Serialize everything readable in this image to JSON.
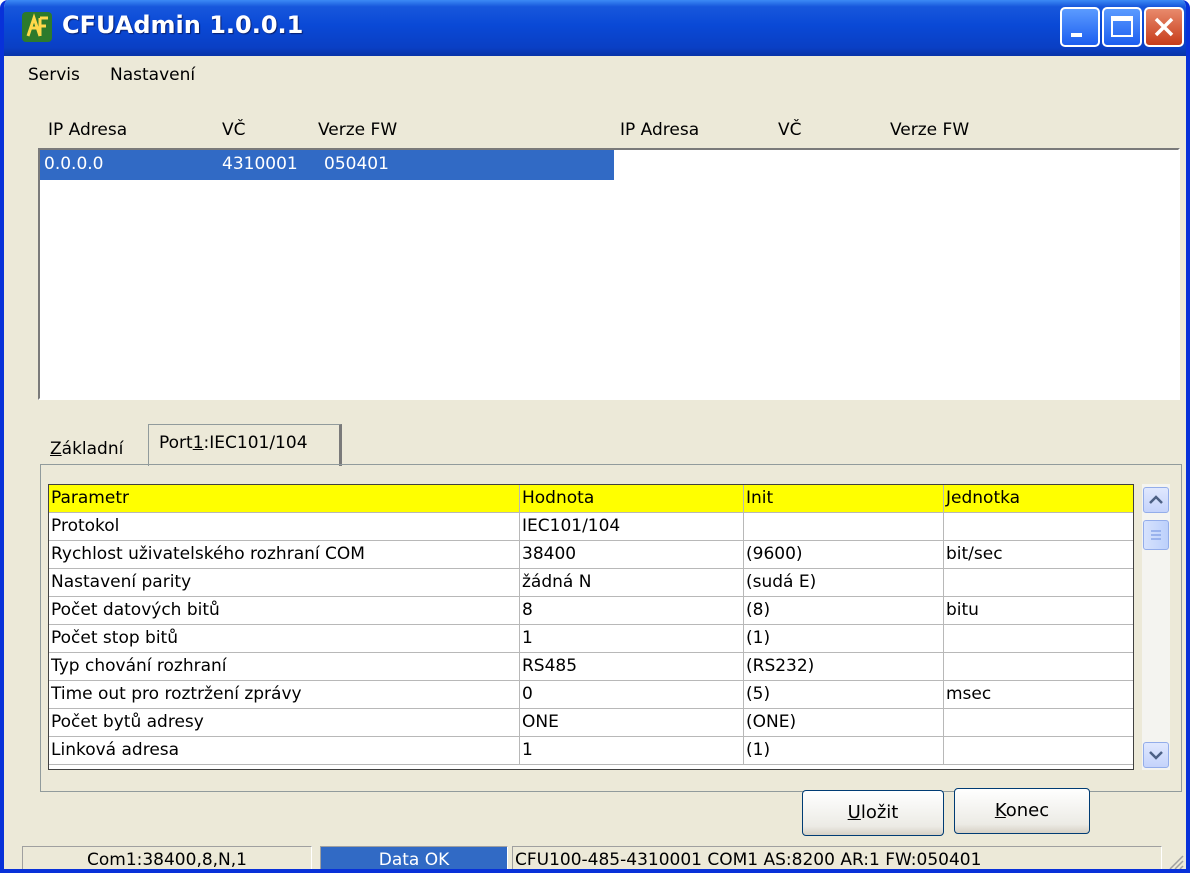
{
  "window": {
    "title": "CFUAdmin 1.0.0.1"
  },
  "menu": {
    "items": [
      "Servis",
      "Nastavení"
    ]
  },
  "device_list": {
    "headers": [
      "IP Adresa",
      "VČ",
      "Verze FW",
      "IP Adresa",
      "VČ",
      "Verze FW"
    ],
    "rows": [
      {
        "ip": "0.0.0.0",
        "vc": "4310001",
        "fw": "050401"
      }
    ]
  },
  "tabs": {
    "basic_first": "Z",
    "basic_rest": "ákladní",
    "port_pre": "Port",
    "port_u": "1",
    "port_post": ":IEC101/104"
  },
  "grid": {
    "headers": [
      "Parametr",
      "Hodnota",
      "Init",
      "Jednotka"
    ],
    "rows": [
      [
        "Protokol",
        "IEC101/104",
        "",
        ""
      ],
      [
        "Rychlost uživatelského rozhraní COM",
        "38400",
        "(9600)",
        "bit/sec"
      ],
      [
        "Nastavení parity",
        "žádná N",
        "(sudá E)",
        ""
      ],
      [
        "Počet datových bitů",
        "8",
        "(8)",
        "bitu"
      ],
      [
        "Počet stop bitů",
        "1",
        "(1)",
        ""
      ],
      [
        "Typ chování rozhraní",
        "RS485",
        "(RS232)",
        ""
      ],
      [
        "Time out pro roztržení zprávy",
        "0",
        "(5)",
        "msec"
      ],
      [
        "Počet bytů adresy",
        "ONE",
        "(ONE)",
        ""
      ],
      [
        "Linková adresa",
        "1",
        "(1)",
        ""
      ]
    ]
  },
  "buttons": {
    "save_first": "U",
    "save_rest": "ložit",
    "exit_first": "K",
    "exit_rest": "onec"
  },
  "status": {
    "port": "Com1:38400,8,N,1",
    "state": "Data OK",
    "info": "CFU100-485-4310001 COM1 AS:8200 AR:1 FW:050401"
  },
  "colors": {
    "selection": "#316ac5",
    "grid_header": "#ffff00",
    "titlebar": "#0a49d6",
    "status_ok": "#316ac5"
  }
}
